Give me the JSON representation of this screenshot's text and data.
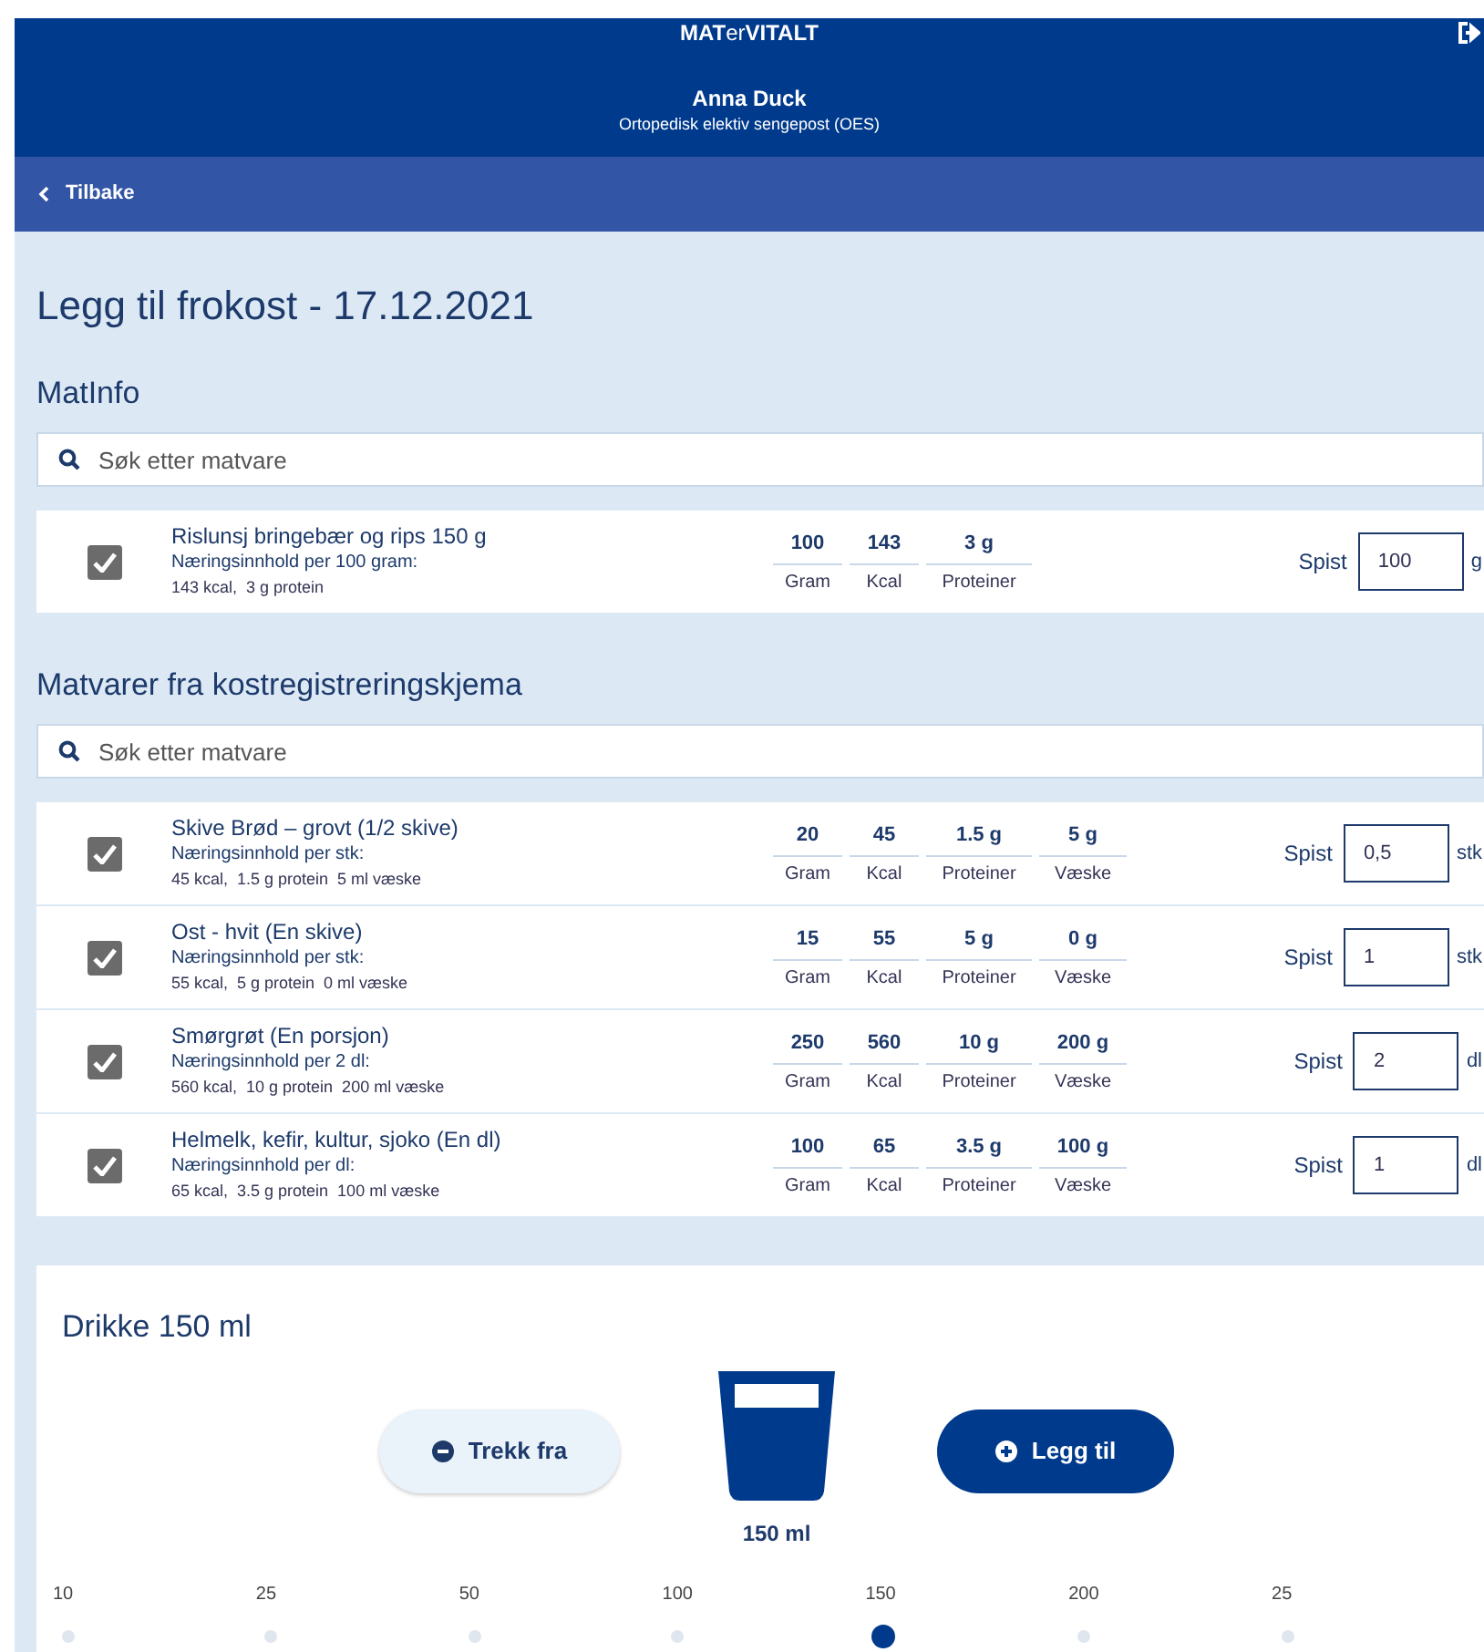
{
  "header": {
    "logo": "**MAT**er**VITALT**",
    "patient": "Anna Duck",
    "ward": "Ortopedisk elektiv sengepost (OES)"
  },
  "nav": {
    "back": "Tilbake"
  },
  "title": "Legg til frokost - 17.12.2021",
  "sections": [
    {
      "heading": "MatInfo",
      "search": {
        "placeholder": "Søk etter matvare"
      },
      "items": [
        {
          "checked": true,
          "name": "Rislunsj bringebær og rips 150 g",
          "basis": "Næringsinnhold per 100 gram:",
          "summary": "143 kcal,  3 g protein",
          "values": [
            {
              "value": "100",
              "label": "Gram"
            },
            {
              "value": "143",
              "label": "Kcal"
            },
            {
              "value": "3 g",
              "label": "Proteiner"
            }
          ],
          "eaten_label": "Spist",
          "eaten": "100",
          "unit": "g"
        }
      ]
    },
    {
      "heading": "Matvarer fra kostregistreringskjema",
      "search": {
        "placeholder": "Søk etter matvare"
      },
      "items": [
        {
          "checked": true,
          "name": "Skive Brød – grovt (1/2 skive)",
          "basis": "Næringsinnhold per stk:",
          "summary": "45 kcal,  1.5 g protein  5 ml væske",
          "values": [
            {
              "value": "20",
              "label": "Gram"
            },
            {
              "value": "45",
              "label": "Kcal"
            },
            {
              "value": "1.5 g",
              "label": "Proteiner"
            },
            {
              "value": "5 g",
              "label": "Væske"
            }
          ],
          "eaten_label": "Spist",
          "eaten": "0,5",
          "unit": "stk"
        },
        {
          "checked": true,
          "name": "Ost - hvit (En skive)",
          "basis": "Næringsinnhold per stk:",
          "summary": "55 kcal,  5 g protein  0 ml væske",
          "values": [
            {
              "value": "15",
              "label": "Gram"
            },
            {
              "value": "55",
              "label": "Kcal"
            },
            {
              "value": "5 g",
              "label": "Proteiner"
            },
            {
              "value": "0 g",
              "label": "Væske"
            }
          ],
          "eaten_label": "Spist",
          "eaten": "1",
          "unit": "stk"
        },
        {
          "checked": true,
          "name": "Smørgrøt (En porsjon)",
          "basis": "Næringsinnhold per 2 dl:",
          "summary": "560 kcal,  10 g protein  200 ml væske",
          "values": [
            {
              "value": "250",
              "label": "Gram"
            },
            {
              "value": "560",
              "label": "Kcal"
            },
            {
              "value": "10 g",
              "label": "Proteiner"
            },
            {
              "value": "200 g",
              "label": "Væske"
            }
          ],
          "eaten_label": "Spist",
          "eaten": "2",
          "unit": "dl"
        },
        {
          "checked": true,
          "name": "Helmelk, kefir, kultur, sjoko (En dl)",
          "basis": "Næringsinnhold per dl:",
          "summary": "65 kcal,  3.5 g protein  100 ml væske",
          "values": [
            {
              "value": "100",
              "label": "Gram"
            },
            {
              "value": "65",
              "label": "Kcal"
            },
            {
              "value": "3.5 g",
              "label": "Proteiner"
            },
            {
              "value": "100 g",
              "label": "Væske"
            }
          ],
          "eaten_label": "Spist",
          "eaten": "1",
          "unit": "dl"
        }
      ]
    }
  ],
  "drink": {
    "heading": "Drikke 150 ml",
    "subtract": "Trekk fra",
    "add": "Legg til",
    "amount": "150 ml",
    "stops": [
      {
        "label": "10",
        "selected": false
      },
      {
        "label": "25",
        "selected": false
      },
      {
        "label": "50",
        "selected": false
      },
      {
        "label": "100",
        "selected": false
      },
      {
        "label": "150",
        "selected": true
      },
      {
        "label": "200",
        "selected": false
      },
      {
        "label": "25",
        "selected": false
      }
    ]
  }
}
